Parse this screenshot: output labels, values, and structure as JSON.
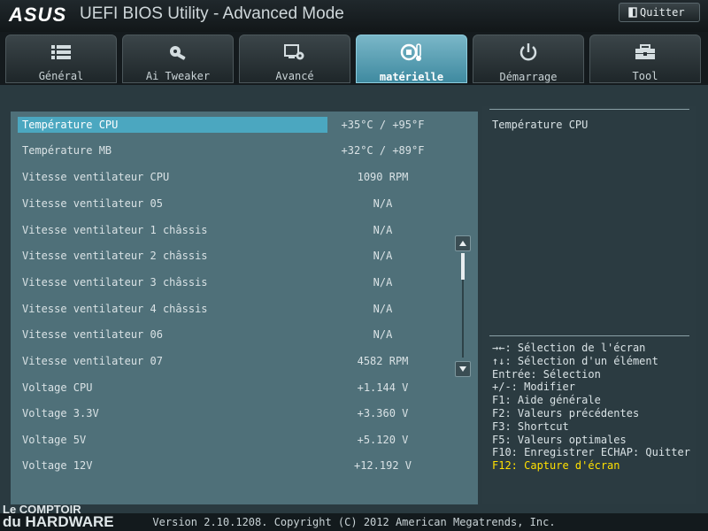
{
  "header": {
    "brand": "ASUS",
    "title": "UEFI BIOS Utility - Advanced Mode",
    "exit_label": "Quitter"
  },
  "tabs": [
    {
      "label": "Général",
      "icon": "list-icon"
    },
    {
      "label": "Ai Tweaker",
      "icon": "ai-tweaker-icon"
    },
    {
      "label": "Avancé",
      "icon": "advanced-icon"
    },
    {
      "label": "matérielle",
      "icon": "hardware-monitor-icon",
      "active": true
    },
    {
      "label": "Démarrage",
      "icon": "power-icon"
    },
    {
      "label": "Tool",
      "icon": "toolbox-icon"
    }
  ],
  "monitor": {
    "rows": [
      {
        "name": "Température CPU",
        "value": "+35°C / +95°F"
      },
      {
        "name": "Température MB",
        "value": "+32°C / +89°F"
      },
      {
        "name": "Vitesse ventilateur CPU",
        "value": "1090 RPM"
      },
      {
        "name": "Vitesse ventilateur 05",
        "value": "N/A"
      },
      {
        "name": "Vitesse ventilateur 1 châssis",
        "value": "N/A"
      },
      {
        "name": "Vitesse ventilateur 2 châssis",
        "value": "N/A"
      },
      {
        "name": "Vitesse ventilateur 3 châssis",
        "value": "N/A"
      },
      {
        "name": "Vitesse ventilateur 4 châssis",
        "value": "N/A"
      },
      {
        "name": "Vitesse ventilateur 06",
        "value": "N/A"
      },
      {
        "name": "Vitesse ventilateur 07",
        "value": "4582 RPM"
      },
      {
        "name": "Voltage CPU",
        "value": "+1.144 V"
      },
      {
        "name": "Voltage 3.3V",
        "value": "+3.360 V"
      },
      {
        "name": "Voltage 5V",
        "value": "+5.120 V"
      },
      {
        "name": "Voltage 12V",
        "value": "+12.192 V"
      }
    ]
  },
  "help": {
    "title": "Température CPU",
    "keys": [
      "→←: Sélection de l'écran",
      "↑↓: Sélection d'un élément",
      "Entrée: Sélection",
      "+/-: Modifier",
      "F1: Aide générale",
      "F2: Valeurs précédentes",
      "F3: Shortcut",
      "F5: Valeurs optimales",
      "F10: Enregistrer  ECHAP: Quitter"
    ],
    "highlight_key": "F12: Capture d'écran"
  },
  "footer": {
    "version": "Version 2.10.1208. Copyright (C) 2012 American Megatrends, Inc."
  },
  "watermark": {
    "line1": "Le COMPTOIR",
    "line2": "du HARDWARE"
  },
  "colors": {
    "accent": "#4ba7c0",
    "panel": "#4f7079",
    "highlight": "#ffe000"
  }
}
